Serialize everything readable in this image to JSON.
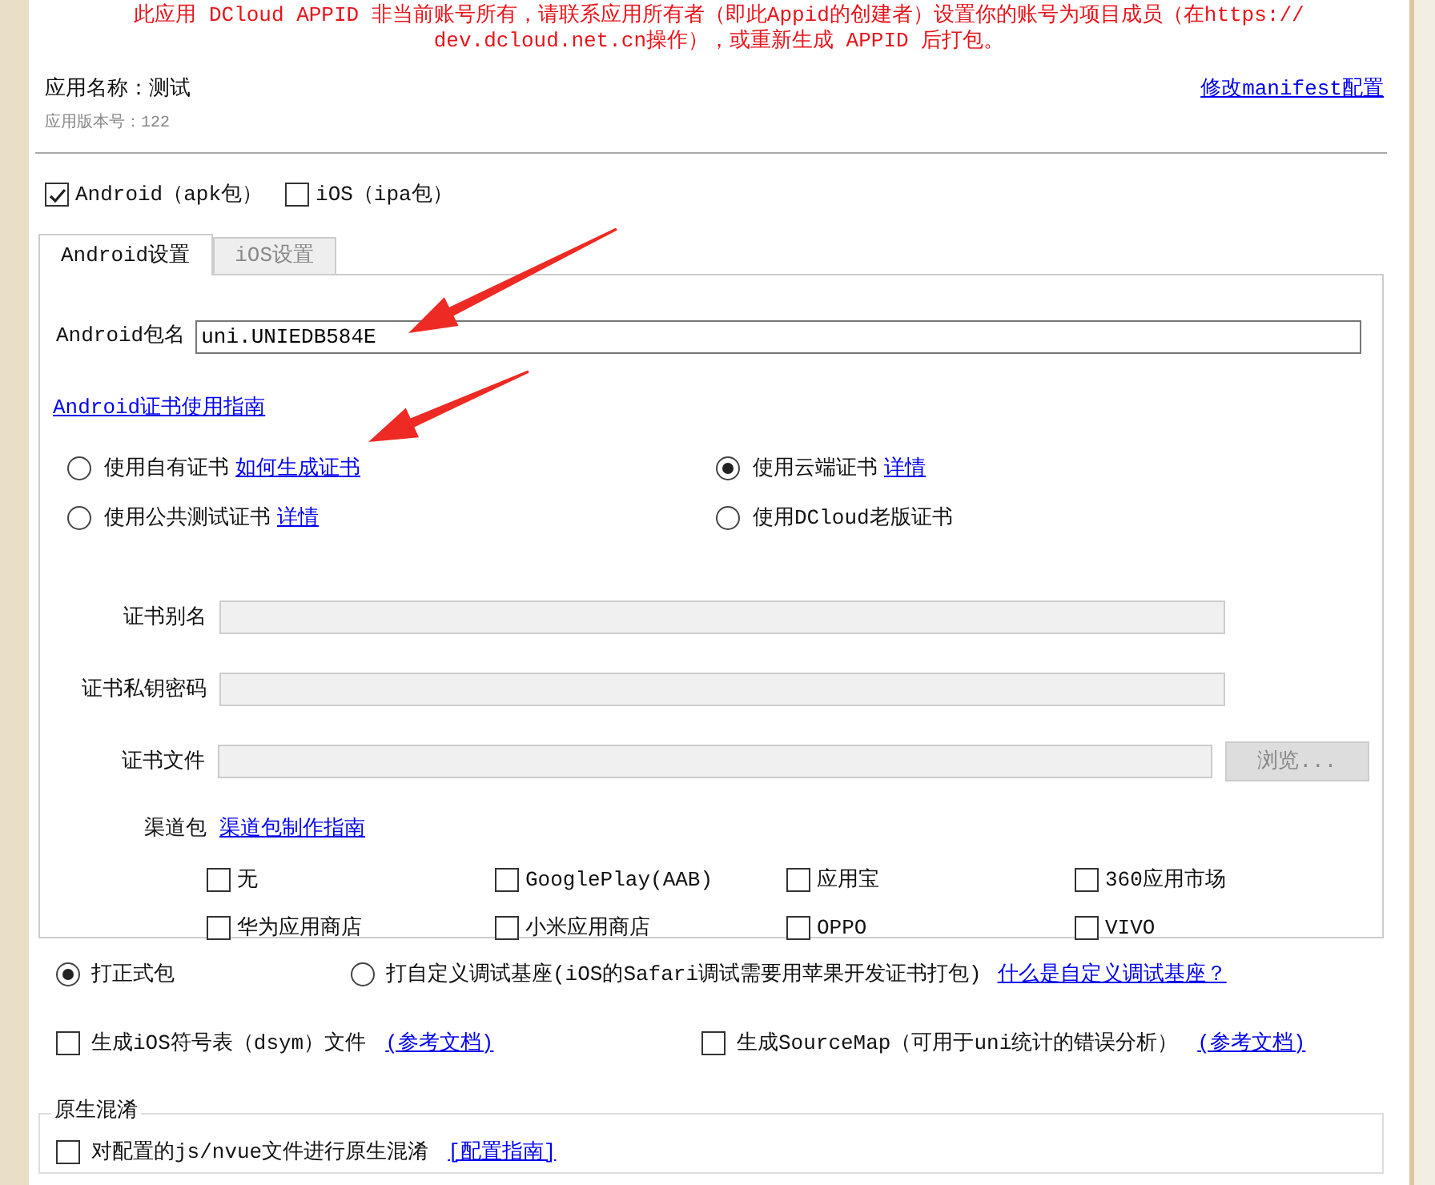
{
  "warning_lines": [
    "此应用 DCloud APPID 非当前账号所有，请联系应用所有者（即此Appid的创建者）设置你的账号为项目成员（在https://",
    "dev.dcloud.net.cn操作），或重新生成 APPID 后打包。"
  ],
  "app_name": "应用名称：测试",
  "app_version": "应用版本号：122",
  "manifest_link": "修改manifest配置",
  "platforms": [
    {
      "label": "Android（apk包）",
      "checked": true
    },
    {
      "label": "iOS（ipa包）",
      "checked": false
    }
  ],
  "tabs": [
    {
      "label": "Android设置",
      "selected": true
    },
    {
      "label": "iOS设置",
      "selected": false
    }
  ],
  "package": {
    "label": "Android包名",
    "value": "uni.UNIEDB584E"
  },
  "cert_guide_link": "Android证书使用指南",
  "cert_options": [
    {
      "label": "使用自有证书",
      "link": "如何生成证书",
      "selected": false
    },
    {
      "label": "使用云端证书",
      "link": "详情",
      "selected": true
    },
    {
      "label": "使用公共测试证书",
      "link": "详情",
      "selected": false
    },
    {
      "label": "使用DCloud老版证书",
      "selected": false
    }
  ],
  "cert_fields": [
    {
      "label": "证书别名",
      "disabled": true
    },
    {
      "label": "证书私钥密码",
      "disabled": true
    },
    {
      "label": "证书文件",
      "disabled": true,
      "button": "浏览..."
    }
  ],
  "channel": {
    "label": "渠道包",
    "link": "渠道包制作指南",
    "items": [
      {
        "label": "无",
        "checked": false
      },
      {
        "label": "GooglePlay(AAB)",
        "checked": false
      },
      {
        "label": "应用宝",
        "checked": false
      },
      {
        "label": "360应用市场",
        "checked": false
      },
      {
        "label": "华为应用商店",
        "checked": false
      },
      {
        "label": "小米应用商店",
        "checked": false
      },
      {
        "label": "OPPO",
        "checked": false
      },
      {
        "label": "VIVO",
        "checked": false
      }
    ]
  },
  "build_types": [
    {
      "label": "打正式包",
      "selected": true
    },
    {
      "label": "打自定义调试基座(iOS的Safari调试需要用苹果开发证书打包)",
      "selected": false,
      "link": "什么是自定义调试基座？"
    }
  ],
  "options": [
    {
      "label": "生成iOS符号表（dsym）文件",
      "link": "(参考文档)",
      "checked": false
    },
    {
      "label": "生成SourceMap（可用于uni统计的错误分析）",
      "link": "(参考文档)",
      "checked": false
    }
  ],
  "obfuscation": {
    "legend": "原生混淆",
    "label": "对配置的js/nvue文件进行原生混淆",
    "link": "[配置指南]",
    "checked": false
  }
}
